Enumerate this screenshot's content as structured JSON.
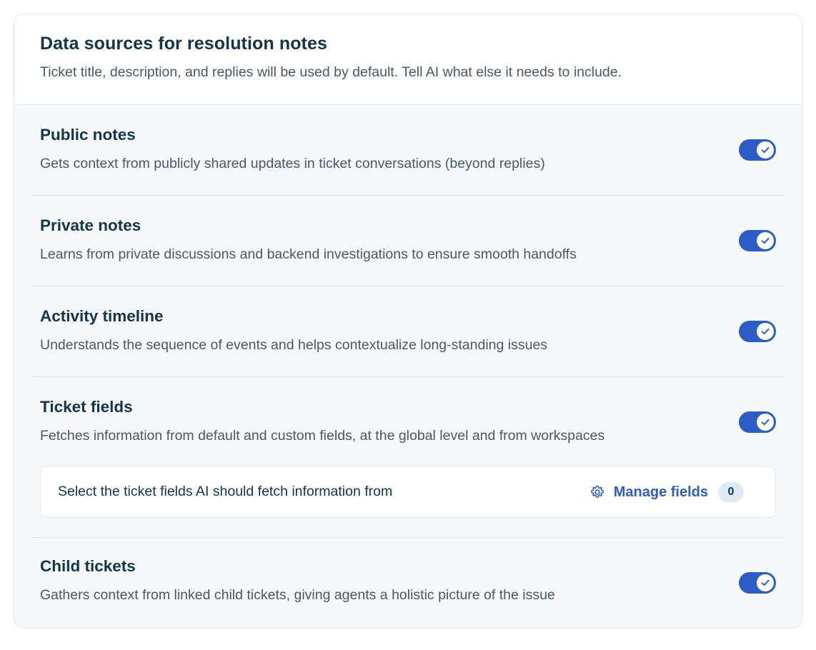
{
  "header": {
    "title": "Data sources for resolution notes",
    "subtitle": "Ticket title, description, and replies will be used by default. Tell AI what else it needs to include."
  },
  "sections": [
    {
      "title": "Public notes",
      "description": "Gets context from publicly shared updates in ticket conversations (beyond replies)",
      "enabled": true
    },
    {
      "title": "Private notes",
      "description": "Learns from private discussions and backend investigations to ensure smooth handoffs",
      "enabled": true
    },
    {
      "title": "Activity timeline",
      "description": "Understands the sequence of events and helps contextualize long-standing issues",
      "enabled": true
    },
    {
      "title": "Ticket fields",
      "description": "Fetches information from default and custom fields, at the global level and from workspaces",
      "enabled": true
    },
    {
      "title": "Child tickets",
      "description": "Gathers context from linked child tickets, giving agents a holistic picture of the issue",
      "enabled": true
    }
  ],
  "ticket_fields_panel": {
    "prompt": "Select the ticket fields AI should fetch information from",
    "manage_label": "Manage fields",
    "icon": "gear-icon",
    "count": "0"
  },
  "colors": {
    "accent": "#2c5cc5",
    "title_text": "#12344d",
    "body_text": "#475867",
    "badge_bg": "#dfeaf7"
  }
}
